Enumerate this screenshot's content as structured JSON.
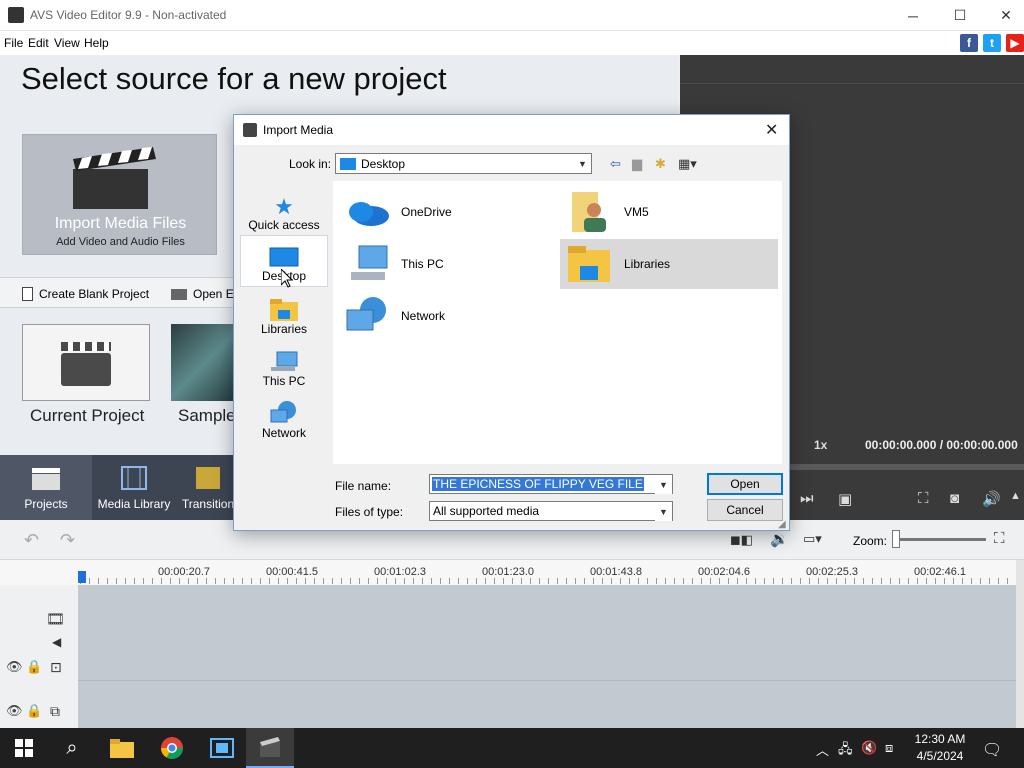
{
  "window": {
    "title": "AVS Video Editor 9.9 - Non-activated",
    "minimize": "─",
    "maximize": "☐",
    "close": "✕"
  },
  "menu": [
    "File",
    "Edit",
    "View",
    "Help"
  ],
  "social": {
    "facebook": "f",
    "twitter": "t",
    "youtube": "▶"
  },
  "start": {
    "page_title": "Select source for a new project",
    "import_title": "Import Media Files",
    "import_sub": "Add Video and Audio Files",
    "create_blank": "Create Blank Project",
    "open_existing": "Open Ex",
    "current_project": "Current Project",
    "sample": "Sample"
  },
  "preview": {
    "speed": "1x",
    "time": "00:00:00.000 / 00:00:00.000"
  },
  "tabs": [
    "Projects",
    "Media Library",
    "Transition"
  ],
  "toolbar": {
    "zoom_label": "Zoom:"
  },
  "ruler": [
    "00:00:20.7",
    "00:00:41.5",
    "00:01:02.3",
    "00:01:23.0",
    "00:01:43.8",
    "00:02:04.6",
    "00:02:25.3",
    "00:02:46.1"
  ],
  "dialog": {
    "title": "Import Media",
    "look_in_label": "Look in:",
    "look_in_value": "Desktop",
    "places": [
      "Quick access",
      "Desktop",
      "Libraries",
      "This PC",
      "Network"
    ],
    "files": [
      "OneDrive",
      "VM5",
      "This PC",
      "Libraries",
      "Network"
    ],
    "file_name_label": "File name:",
    "file_name_value": "THE EPICNESS OF FLIPPY VEG FILE",
    "file_type_label": "Files of type:",
    "file_type_value": "All supported media",
    "open": "Open",
    "cancel": "Cancel"
  },
  "taskbar": {
    "time": "12:30 AM",
    "date": "4/5/2024"
  },
  "colors": {
    "accent": "#0078d7",
    "tab_bg": "#3e4552",
    "preview_bg": "#3a3a3a",
    "selection": "#3378d6"
  }
}
